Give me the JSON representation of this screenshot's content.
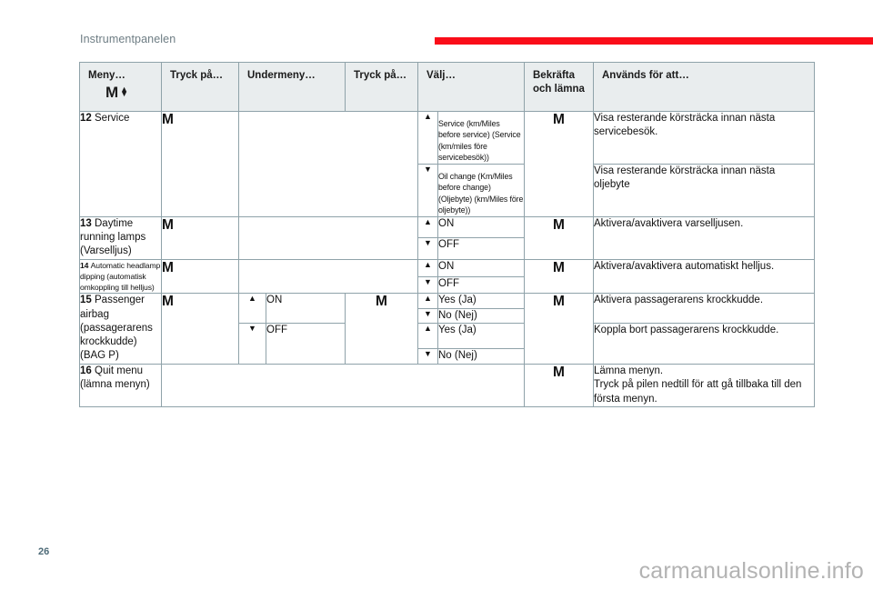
{
  "header": {
    "section_title": "Instrumentpanelen",
    "rule_color": "#fa0d19"
  },
  "table": {
    "columns": [
      {
        "label": "Meny…",
        "badge": "M",
        "arrow_up": "▲",
        "arrow_down": "▼"
      },
      {
        "label": "Tryck på…"
      },
      {
        "label": "Undermeny…"
      },
      {
        "label": "Tryck på…"
      },
      {
        "label": "Välj…"
      },
      {
        "label": "Bekräfta och lämna"
      },
      {
        "label": "Används för att…"
      }
    ],
    "rows": [
      {
        "num": "12",
        "name": "Service",
        "press1": "M",
        "submenu": "",
        "press2": "",
        "confirm": "M",
        "options": [
          {
            "arrow": "▲",
            "label": "Service (km/Miles before service) (Service (km/miles före servicebesök))",
            "desc": "Visa resterande körsträcka innan nästa servicebesök."
          },
          {
            "arrow": "▼",
            "label": "Oil change (Km/Miles before change) (Oljebyte) (km/Miles före oljebyte))",
            "desc": "Visa resterande körsträcka innan nästa oljebyte"
          }
        ]
      },
      {
        "num": "13",
        "name": "Daytime running lamps (Varselljus)",
        "press1": "M",
        "submenu": "",
        "press2": "",
        "confirm": "M",
        "options": [
          {
            "arrow": "▲",
            "label": "ON",
            "desc": "Aktivera/avaktivera varselljusen."
          },
          {
            "arrow": "▼",
            "label": "OFF",
            "desc": ""
          }
        ]
      },
      {
        "num": "14",
        "name": "Automatic headlamp dipping (automatisk omkoppling till helljus)",
        "press1": "M",
        "submenu": "",
        "press2": "",
        "confirm": "M",
        "options": [
          {
            "arrow": "▲",
            "label": "ON",
            "desc": "Aktivera/avaktivera automatiskt helljus."
          },
          {
            "arrow": "▼",
            "label": "OFF",
            "desc": ""
          }
        ]
      },
      {
        "num": "15",
        "name": "Passenger airbag (passagerarens krockkudde) (BAG P)",
        "press1": "M",
        "press2": "M",
        "confirm": "M",
        "submenus": [
          {
            "arrow": "▲",
            "label": "ON"
          },
          {
            "arrow": "▼",
            "label": "OFF"
          }
        ],
        "options": [
          {
            "arrow": "▲",
            "label": "Yes (Ja)",
            "desc": "Aktivera passagerarens krockkudde."
          },
          {
            "arrow": "▼",
            "label": "No (Nej)",
            "desc": ""
          },
          {
            "arrow": "▲",
            "label": "Yes (Ja)",
            "desc": "Koppla bort passagerarens krockkudde."
          },
          {
            "arrow": "▼",
            "label": "No (Nej)",
            "desc": ""
          }
        ]
      },
      {
        "num": "16",
        "name": "Quit menu (lämna menyn)",
        "press1": "",
        "submenu": "",
        "press2": "",
        "confirm": "M",
        "desc_line1": "Lämna menyn.",
        "desc_line2": "Tryck på pilen nedtill för att gå tillbaka till den första menyn."
      }
    ]
  },
  "footer": {
    "page_number": "26",
    "watermark": "carmanualsonline.info"
  }
}
